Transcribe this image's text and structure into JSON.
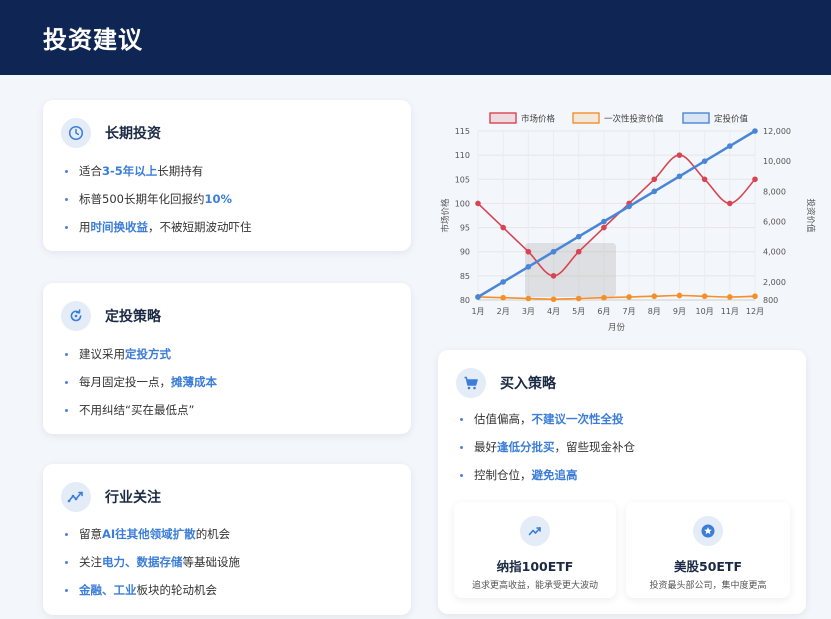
{
  "header": {
    "title": "投资建议"
  },
  "cards": {
    "long": {
      "title": "长期投资",
      "icon": "clock-icon",
      "items": [
        [
          "适合",
          "3-5年以上",
          "长期持有"
        ],
        [
          "标普500长期年化回报约",
          "10%",
          ""
        ],
        [
          "用",
          "时间换收益",
          "，不被短期波动吓住"
        ]
      ]
    },
    "dca": {
      "title": "定投策略",
      "icon": "refresh-icon",
      "items": [
        [
          "建议采用",
          "定投方式",
          ""
        ],
        [
          "每月固定投一点，",
          "摊薄成本",
          ""
        ],
        [
          "不用纠结“买在最低点”",
          "",
          ""
        ]
      ]
    },
    "industry": {
      "title": "行业关注",
      "icon": "trend-icon",
      "items": [
        [
          "留意",
          "AI往其他领域扩散",
          "的机会"
        ],
        [
          "关注",
          "电力、数据存储",
          "等基础设施"
        ],
        [
          "",
          "金融、工业",
          "板块的轮动机会"
        ]
      ]
    },
    "buy": {
      "title": "买入策略",
      "icon": "cart-icon",
      "items": [
        [
          "估值偏高，",
          "不建议一次性全投",
          ""
        ],
        [
          "最好",
          "逢低分批买",
          "，留些现金补仓"
        ],
        [
          "控制仓位，",
          "避免追高",
          ""
        ]
      ],
      "funds": [
        {
          "name": "纳指100ETF",
          "desc": "追求更高收益，能承受更大波动",
          "icon": "trend-up-icon"
        },
        {
          "name": "美股50ETF",
          "desc": "投资最头部公司，集中度更高",
          "icon": "star-badge-icon"
        }
      ]
    }
  },
  "colors": {
    "header_bg": "#0f2553",
    "accent": "#3b7dd8",
    "market": "#d94452",
    "lump": "#f58f2a",
    "dca": "#4a86d8"
  },
  "chart_data": {
    "type": "line",
    "categories": [
      "1月",
      "2月",
      "3月",
      "4月",
      "5月",
      "6月",
      "7月",
      "8月",
      "9月",
      "10月",
      "11月",
      "12月"
    ],
    "xlabel": "月份",
    "ylabel": "市场价格",
    "y2label": "投资价值",
    "ylim": [
      80,
      115
    ],
    "y2lim": [
      800,
      12000
    ],
    "yticks": [
      80,
      85,
      90,
      95,
      100,
      105,
      110,
      115
    ],
    "y2ticks": [
      800,
      2000,
      4000,
      6000,
      8000,
      10000,
      12000
    ],
    "y2tick_labels": [
      "800",
      "2,000",
      "4,000",
      "6,000",
      "8,000",
      "10,000",
      "12,000"
    ],
    "legend_position": "top",
    "grid": true,
    "series": [
      {
        "name": "市场价格",
        "axis": "left",
        "values": [
          100,
          95,
          90,
          85,
          90,
          95,
          100,
          105,
          110,
          105,
          100,
          105
        ]
      },
      {
        "name": "一次性投资价值",
        "axis": "right",
        "values": [
          1000,
          950,
          900,
          850,
          900,
          950,
          1000,
          1050,
          1100,
          1050,
          1000,
          1050
        ]
      },
      {
        "name": "定投价值",
        "axis": "right",
        "values": [
          1000,
          2000,
          3000,
          4000,
          5000,
          6000,
          7000,
          8000,
          9000,
          10000,
          11000,
          12000
        ]
      }
    ]
  }
}
